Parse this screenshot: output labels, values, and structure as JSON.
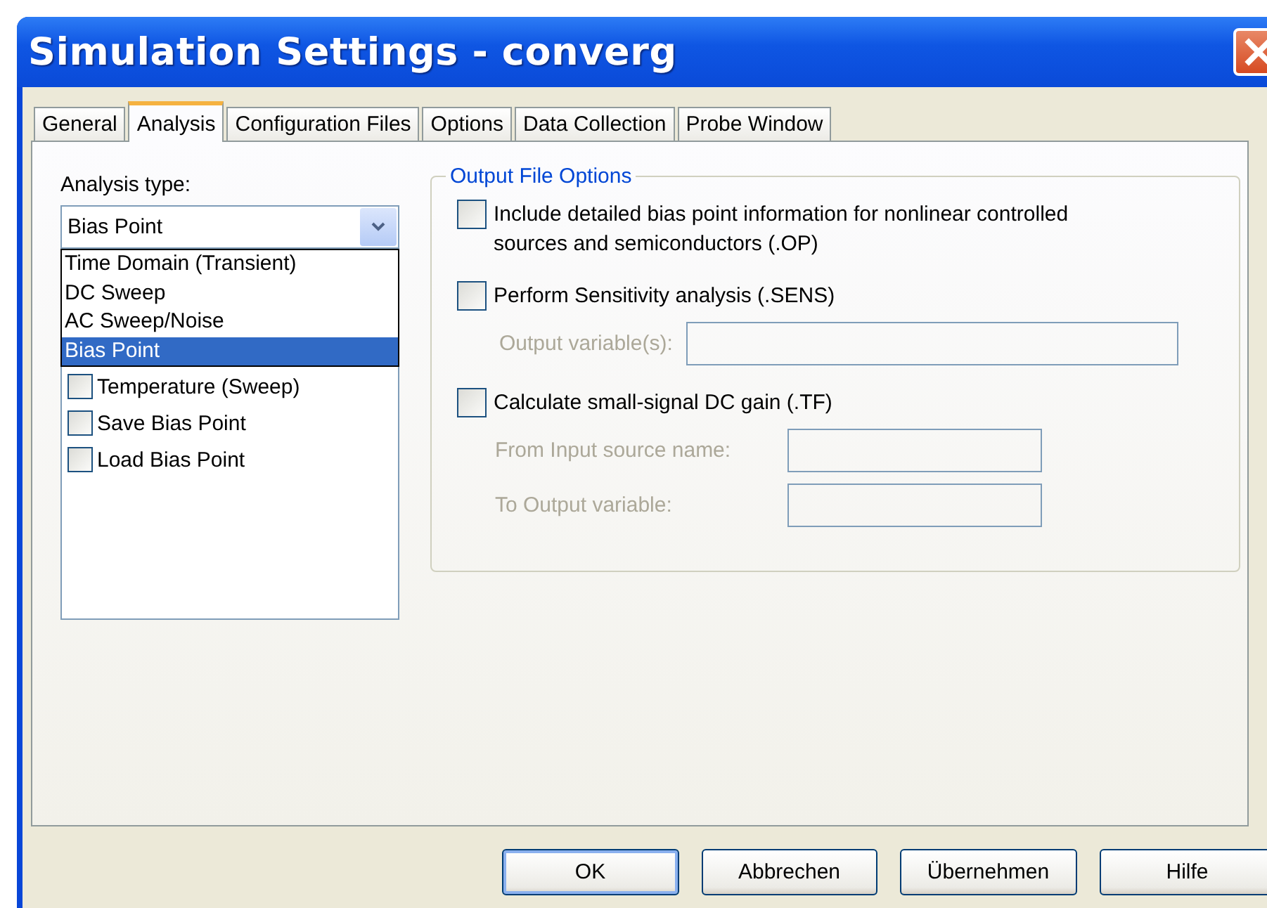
{
  "window": {
    "title": "Simulation Settings - converg"
  },
  "tabs": [
    {
      "label": "General",
      "selected": false
    },
    {
      "label": "Analysis",
      "selected": true
    },
    {
      "label": "Configuration Files",
      "selected": false
    },
    {
      "label": "Options",
      "selected": false
    },
    {
      "label": "Data Collection",
      "selected": false
    },
    {
      "label": "Probe Window",
      "selected": false
    }
  ],
  "analysis_type": {
    "label": "Analysis type:",
    "value": "Bias Point",
    "expanded": true,
    "options": [
      {
        "label": "Time Domain (Transient)",
        "selected": false
      },
      {
        "label": "DC Sweep",
        "selected": false
      },
      {
        "label": "AC Sweep/Noise",
        "selected": false
      },
      {
        "label": "Bias Point",
        "selected": true
      }
    ]
  },
  "options_list": [
    {
      "label": "Temperature (Sweep)",
      "checked": false
    },
    {
      "label": "Save Bias Point",
      "checked": false
    },
    {
      "label": "Load Bias Point",
      "checked": false
    }
  ],
  "output_file_options": {
    "title": "Output File Options",
    "items": [
      {
        "label": "Include detailed bias point information for nonlinear controlled sources and semiconductors (.OP)",
        "checked": false
      },
      {
        "label": "Perform Sensitivity analysis (.SENS)",
        "checked": false,
        "fields": [
          {
            "label": "Output variable(s):",
            "disabled": true
          }
        ]
      },
      {
        "label": "Calculate small-signal DC gain (.TF)",
        "checked": false,
        "fields": [
          {
            "label": "From Input source name:",
            "disabled": true
          },
          {
            "label": "To Output variable:",
            "disabled": true
          }
        ]
      }
    ]
  },
  "buttons": [
    {
      "label": "OK",
      "default": true
    },
    {
      "label": "Abbrechen",
      "default": false
    },
    {
      "label": "Übernehmen",
      "default": false
    },
    {
      "label": "Hilfe",
      "default": false
    }
  ]
}
